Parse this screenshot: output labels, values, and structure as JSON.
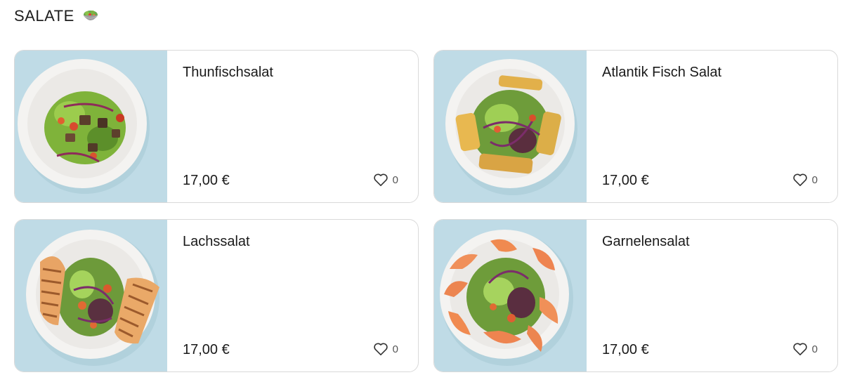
{
  "section": {
    "title": "SALATE",
    "emoji_icon": "green-salad-bowl-icon"
  },
  "colors": {
    "thumb_background": "#bfdbe6",
    "card_border": "#d9d9d9",
    "text": "#1a1a1a"
  },
  "items": [
    {
      "name": "Thunfischsalat",
      "price": "17,00 €",
      "likes": "0",
      "image_icon": "tuna-salad-plate-image",
      "like_icon": "heart-outline-icon"
    },
    {
      "name": "Atlantik Fisch Salat",
      "price": "17,00 €",
      "likes": "0",
      "image_icon": "fish-salad-plate-image",
      "like_icon": "heart-outline-icon"
    },
    {
      "name": "Lachssalat",
      "price": "17,00 €",
      "likes": "0",
      "image_icon": "salmon-salad-plate-image",
      "like_icon": "heart-outline-icon"
    },
    {
      "name": "Garnelensalat",
      "price": "17,00 €",
      "likes": "0",
      "image_icon": "shrimp-salad-plate-image",
      "like_icon": "heart-outline-icon"
    }
  ]
}
